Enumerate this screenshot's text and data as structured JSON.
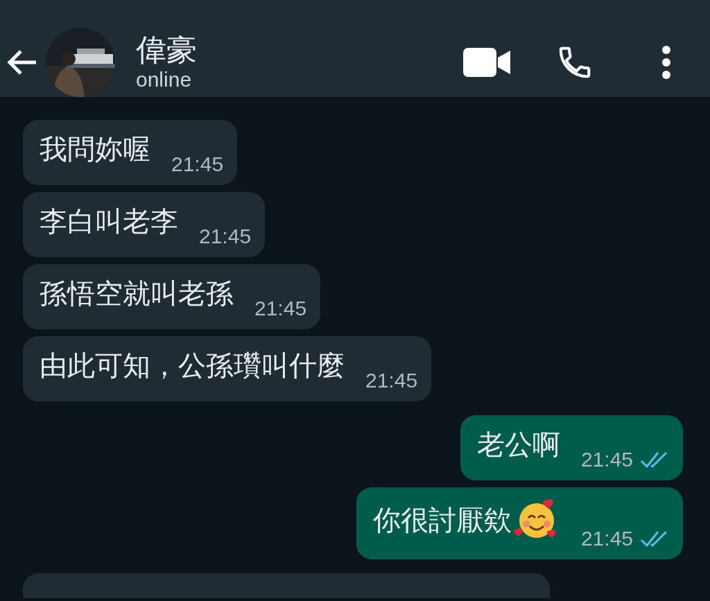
{
  "header": {
    "contact_name": "偉豪",
    "status": "online"
  },
  "messages": [
    {
      "kind": "incoming",
      "text": "我問妳喔",
      "time": "21:45"
    },
    {
      "kind": "incoming",
      "text": "李白叫老李",
      "time": "21:45"
    },
    {
      "kind": "incoming",
      "text": "孫悟空就叫老孫",
      "time": "21:45"
    },
    {
      "kind": "incoming",
      "text": "由此可知，公孫瓚叫什麼",
      "time": "21:45"
    },
    {
      "kind": "outgoing",
      "text": "老公啊",
      "time": "21:45",
      "read": true
    },
    {
      "kind": "outgoing",
      "text": "你很討厭欸",
      "time": "21:45",
      "read": true,
      "emoji": true
    },
    {
      "kind": "cutoff"
    }
  ]
}
